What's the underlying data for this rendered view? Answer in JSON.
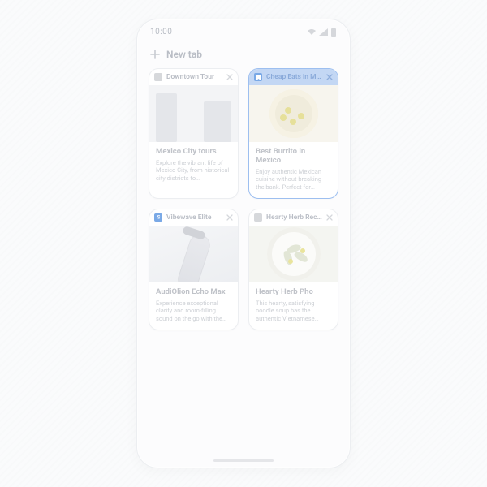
{
  "status": {
    "time": "10:00"
  },
  "newtab": {
    "label": "New tab"
  },
  "tabs": [
    {
      "label": "Downtown Tour",
      "title": "Mexico City tours",
      "desc": "Explore the vibrant life of Mexico City, from historical city districts to gastronomic adventures.",
      "selected": false,
      "thumb": "city",
      "fav": "mono"
    },
    {
      "label": "Cheap Eats in M…",
      "title": "Best Burrito in Mexico",
      "desc": "Enjoy authentic Mexican cuisine without breaking the bank. Perfect for travelers on a budget.",
      "selected": true,
      "thumb": "food",
      "fav": "blue"
    },
    {
      "label": "Vibewave Elite",
      "title": "AudiOlion Echo Max",
      "desc": "Experience exceptional clarity and room-filling sound on the go with the AudiOlion Echo Max.",
      "selected": false,
      "thumb": "speaker",
      "fav": "blue"
    },
    {
      "label": "Hearty Herb Reci…",
      "title": "Hearty Herb Pho",
      "desc": "This hearty, satisfying noodle soup has the authentic Vietnamese flavor and is easy to make.",
      "selected": false,
      "thumb": "bowl",
      "fav": "mono"
    }
  ]
}
